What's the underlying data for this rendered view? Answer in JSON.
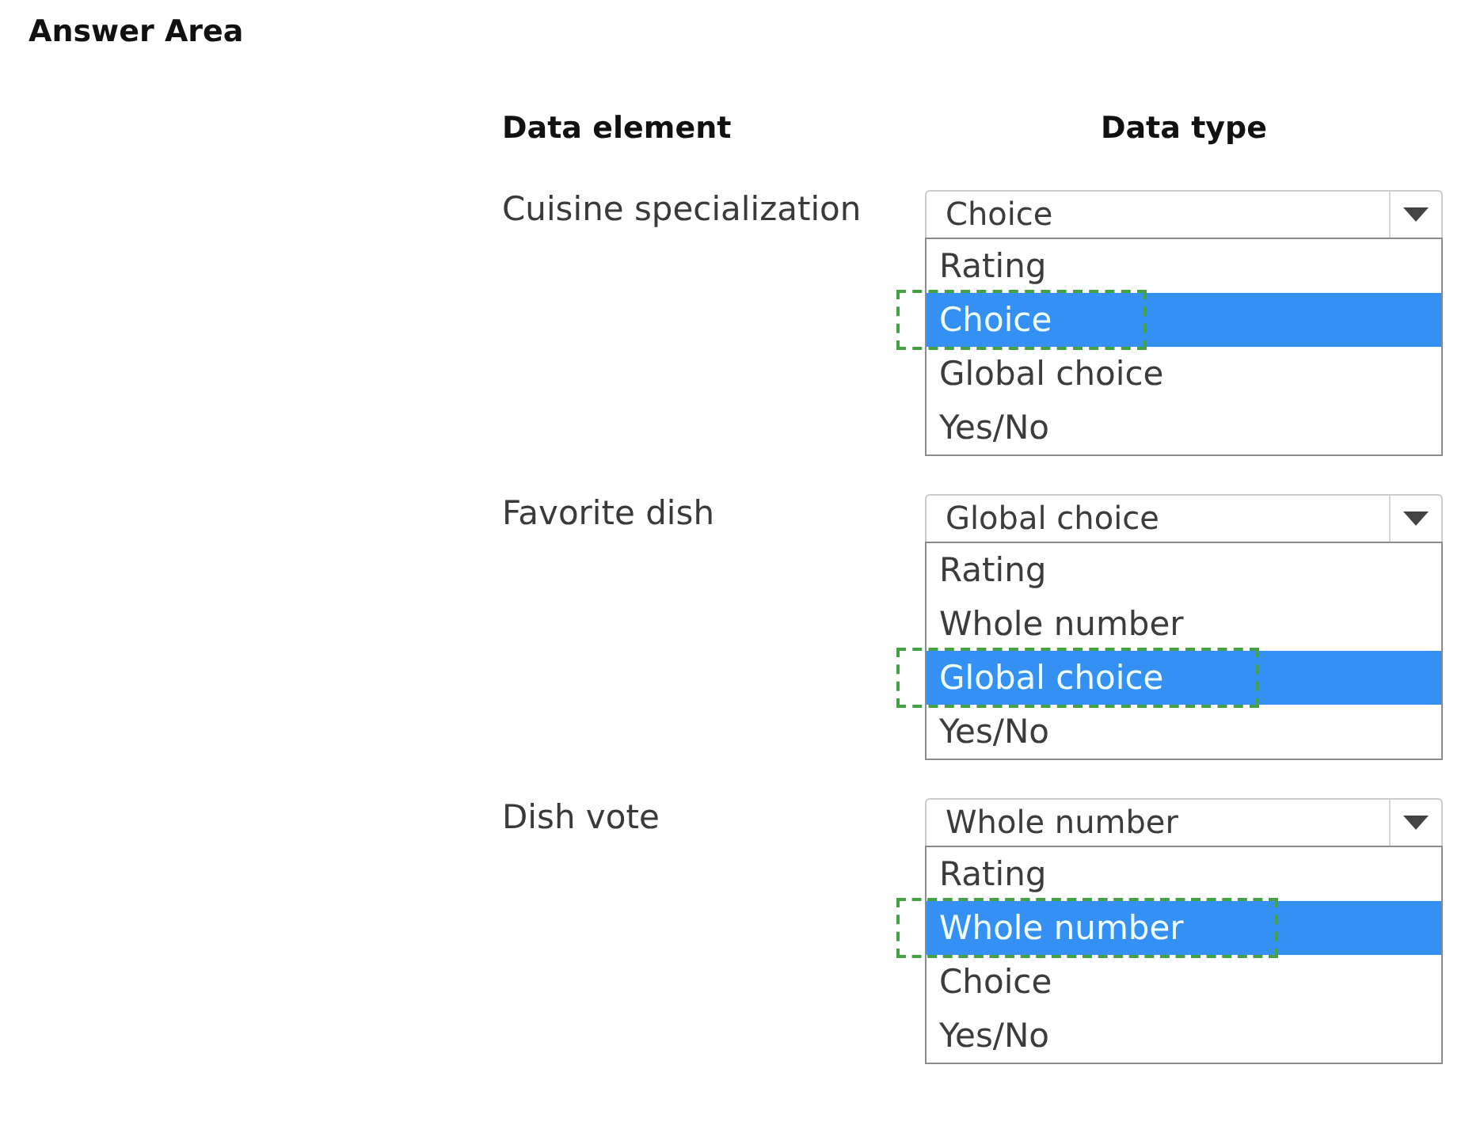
{
  "title": "Answer Area",
  "columns": [
    "Data element",
    "Data type"
  ],
  "rows": [
    {
      "data_element": "Cuisine specialization",
      "dropdown": {
        "value": "Choice",
        "expanded": true,
        "options": [
          {
            "label": "Rating",
            "selected": false
          },
          {
            "label": "Choice",
            "selected": true
          },
          {
            "label": "Global choice",
            "selected": false
          },
          {
            "label": "Yes/No",
            "selected": false
          }
        ]
      }
    },
    {
      "data_element": "Favorite dish",
      "dropdown": {
        "value": "Global choice",
        "expanded": true,
        "options": [
          {
            "label": "Rating",
            "selected": false
          },
          {
            "label": "Whole number",
            "selected": false
          },
          {
            "label": "Global choice",
            "selected": true
          },
          {
            "label": "Yes/No",
            "selected": false
          }
        ]
      }
    },
    {
      "data_element": "Dish vote",
      "dropdown": {
        "value": "Whole number",
        "expanded": true,
        "options": [
          {
            "label": "Rating",
            "selected": false
          },
          {
            "label": "Whole number",
            "selected": true
          },
          {
            "label": "Choice",
            "selected": false
          },
          {
            "label": "Yes/No",
            "selected": false
          }
        ]
      }
    }
  ]
}
